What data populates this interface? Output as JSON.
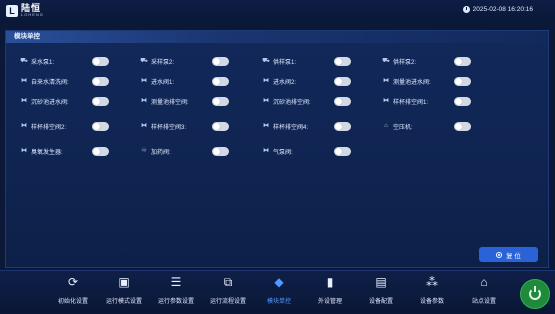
{
  "header": {
    "logo_mark": "L",
    "logo_cn": "陆恒",
    "logo_en": "LOHENG",
    "datetime": "2025-02-08 16:20:16"
  },
  "panel": {
    "title": "模块单控"
  },
  "controls": [
    {
      "label": "采水泵1:",
      "icon": "pump-icon",
      "on": false
    },
    {
      "label": "采样泵2:",
      "icon": "pump-icon",
      "on": false
    },
    {
      "label": "供样泵1:",
      "icon": "pump-icon",
      "on": false
    },
    {
      "label": "供样泵2:",
      "icon": "pump-icon",
      "on": false
    },
    {
      "label": "自来水清洗阀:",
      "icon": "valve-icon",
      "on": false
    },
    {
      "label": "进水阀1:",
      "icon": "valve-icon",
      "on": false
    },
    {
      "label": "进水阀2:",
      "icon": "valve-icon",
      "on": false
    },
    {
      "label": "测量池进水阀:",
      "icon": "valve-icon",
      "on": false
    },
    {
      "label": "沉砂池进水阀:",
      "icon": "valve-icon",
      "on": false
    },
    {
      "label": "测量池排空阀:",
      "icon": "valve-icon",
      "on": false
    },
    {
      "label": "沉砂池排空阀:",
      "icon": "valve-icon",
      "on": false
    },
    {
      "label": "样杯排空阀1:",
      "icon": "valve-icon",
      "on": false
    },
    {
      "label": "样杯排空阀2:",
      "icon": "valve-icon",
      "on": false
    },
    {
      "label": "样杯排空阀3:",
      "icon": "valve-icon",
      "on": false
    },
    {
      "label": "样杯排空阀4:",
      "icon": "valve-icon",
      "on": false
    },
    {
      "label": "空压机:",
      "icon": "compressor-icon",
      "on": false
    },
    {
      "label": "臭氧发生器:",
      "icon": "valve-icon",
      "on": false
    },
    {
      "label": "加药阀:",
      "icon": "dosing-icon",
      "on": false
    },
    {
      "label": "气泵阀:",
      "icon": "valve-icon",
      "on": false
    }
  ],
  "reset_button": {
    "label": "复 位"
  },
  "nav": [
    {
      "label": "初始化设置",
      "icon": "init-icon"
    },
    {
      "label": "运行模式设置",
      "icon": "mode-icon"
    },
    {
      "label": "运行参数设置",
      "icon": "params-icon"
    },
    {
      "label": "运行流程设置",
      "icon": "flow-icon"
    },
    {
      "label": "模块单控",
      "icon": "module-icon",
      "active": true
    },
    {
      "label": "外设管理",
      "icon": "peripheral-icon"
    },
    {
      "label": "设备配置",
      "icon": "device-config-icon"
    },
    {
      "label": "设备参数",
      "icon": "device-params-icon"
    },
    {
      "label": "站点设置",
      "icon": "site-icon"
    }
  ],
  "colors": {
    "background": "#0b1838",
    "panel": "#11285a",
    "accent": "#4f9bff",
    "button": "#2a63d8",
    "power": "#1f8a3a"
  }
}
